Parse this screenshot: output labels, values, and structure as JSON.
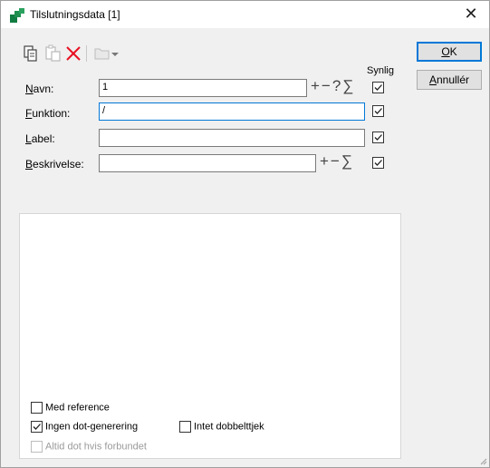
{
  "window": {
    "title": "Tilslutningsdata [1]",
    "close_glyph": "✕"
  },
  "toolbar": {
    "icons": [
      "copy-icon",
      "paste-icon",
      "delete-icon",
      "folder-icon",
      "dropdown-arrow-icon"
    ]
  },
  "buttons": {
    "ok": {
      "accel": "O",
      "rest": "K"
    },
    "cancel": {
      "accel": "A",
      "rest": "nnullér"
    }
  },
  "columns": {
    "visible_header": "Synlig"
  },
  "fields": [
    {
      "accel": "N",
      "rest": "avn:",
      "value": "1",
      "symbols": "+−?∑",
      "visible": true
    },
    {
      "accel": "F",
      "rest": "unktion:",
      "value": "/",
      "symbols": "",
      "visible": true
    },
    {
      "accel": "L",
      "rest": "abel:",
      "value": "",
      "symbols": "",
      "visible": true
    },
    {
      "accel": "B",
      "rest": "eskrivelse:",
      "value": "",
      "symbols": "+−∑",
      "visible": true
    }
  ],
  "options": [
    {
      "label": "Med reference",
      "checked": false,
      "enabled": true
    },
    {
      "label": "Ingen dot-generering",
      "checked": true,
      "enabled": true
    },
    {
      "label": "Intet dobbelttjek",
      "checked": false,
      "enabled": true
    },
    {
      "label": "Altid dot hvis forbundet",
      "checked": false,
      "enabled": false
    }
  ],
  "colors": {
    "accent": "#0078d7",
    "delete_red": "#e81123",
    "title_icon_green": "#107c41"
  }
}
